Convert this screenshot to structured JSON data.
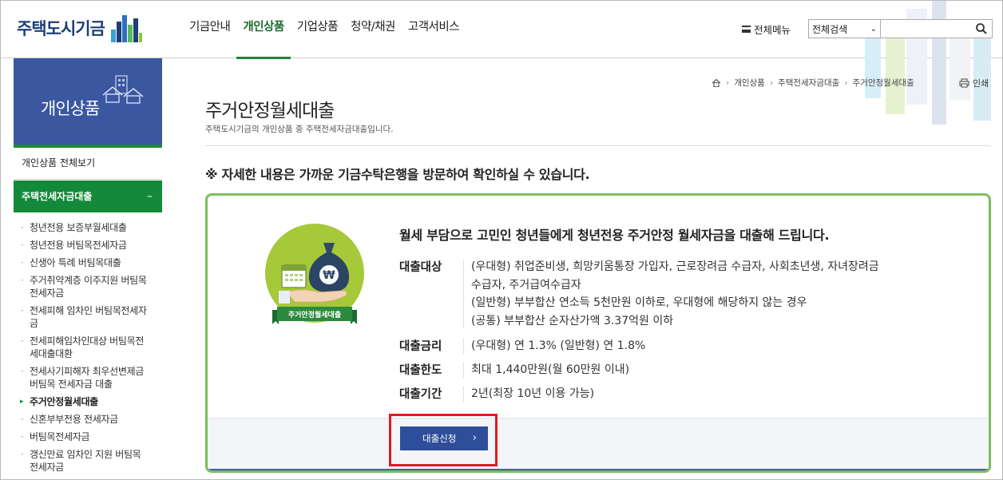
{
  "header": {
    "logo_text": "주택도시기금",
    "gnb": [
      "기금안내",
      "개인상품",
      "기업상품",
      "청약/채권",
      "고객서비스"
    ],
    "gnb_active_index": 1,
    "all_menu": "전체메뉴",
    "search_select": "전체검색",
    "search_placeholder": ""
  },
  "sidebar": {
    "banner_title": "개인상품",
    "all_view": "개인상품 전체보기",
    "group_title": "주택전세자금대출",
    "group_toggle": "–",
    "items": [
      {
        "lines": [
          "청년전용 보증부월세대출"
        ]
      },
      {
        "lines": [
          "청년전용 버팀목전세자금"
        ]
      },
      {
        "lines": [
          "신생아 특례 버팀목대출"
        ]
      },
      {
        "lines": [
          "주거취약계층 이주지원 버팀목",
          "전세자금"
        ]
      },
      {
        "lines": [
          "전세피해 임차인 버팀목전세자",
          "금"
        ]
      },
      {
        "lines": [
          "전세피해임차인대상 버팀목전",
          "세대출대환"
        ]
      },
      {
        "lines": [
          "전세사기피해자 최우선변제금",
          "버팀목 전세자금 대출"
        ]
      },
      {
        "lines": [
          "주거안정월세대출"
        ],
        "active": true
      },
      {
        "lines": [
          "신혼부부전용 전세자금"
        ]
      },
      {
        "lines": [
          "버팀목전세자금"
        ]
      },
      {
        "lines": [
          "갱신만료 임차인 지원 버팀목",
          "전세자금"
        ]
      }
    ]
  },
  "breadcrumb": [
    "개인상품",
    "주택전세자금대출",
    "주거안정월세대출"
  ],
  "print_label": "인쇄",
  "page": {
    "title": "주거안정월세대출",
    "description": "주택도시기금의 개인상품 중 주택전세자금대출입니다.",
    "notice": "※ 자세한 내용은 가까운 기금수탁은행을 방문하여 확인하실 수 있습니다."
  },
  "product": {
    "illustration_label": "주거안정월세대출",
    "currency_symbol": "₩",
    "headline": "월세 부담으로 고민인 청년들에게 청년전용 주거안정 월세자금을 대출해 드립니다.",
    "rows": [
      {
        "label": "대출대상",
        "values": [
          "(우대형) 취업준비생, 희망키움통장 가입자, 근로장려금 수급자, 사회초년생, 자녀장려금",
          "수급자, 주거급여수급자",
          "(일반형) 부부합산 연소득 5천만원 이하로, 우대형에 해당하지 않는 경우",
          "(공통) 부부합산 순자산가액 3.37억원 이하"
        ]
      },
      {
        "label": "대출금리",
        "values": [
          "(우대형) 연 1.3% (일반형) 연 1.8%"
        ]
      },
      {
        "label": "대출한도",
        "values": [
          "최대 1,440만원(월 60만원 이내)"
        ]
      },
      {
        "label": "대출기간",
        "values": [
          "2년(최장 10년 이용 가능)"
        ]
      }
    ],
    "apply_button": "대출신청",
    "apply_chevron": "›"
  },
  "colors": {
    "brand_blue": "#3a57a0",
    "brand_green": "#138a39",
    "box_border": "#7bbf5a",
    "button": "#2e4e9a",
    "highlight": "#e5191d"
  }
}
